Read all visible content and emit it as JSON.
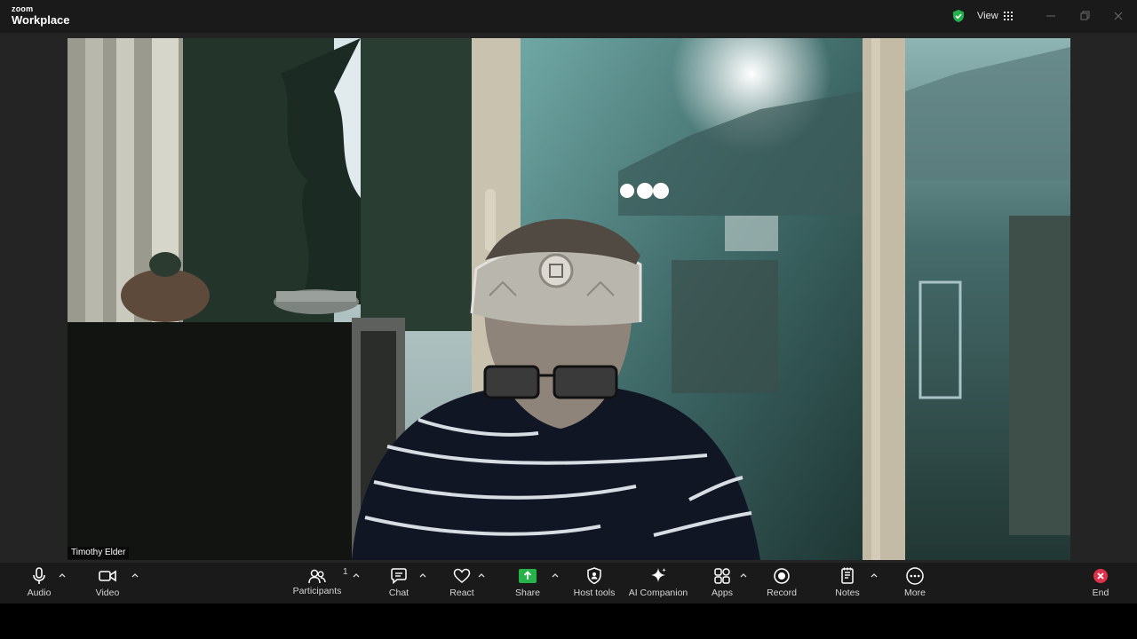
{
  "app": {
    "brand_small": "zoom",
    "brand_large": "Workplace",
    "view_label": "View"
  },
  "participant": {
    "name": "Timothy Elder"
  },
  "toolbar": {
    "audio": "Audio",
    "video": "Video",
    "participants": "Participants",
    "participants_count": "1",
    "chat": "Chat",
    "react": "React",
    "share": "Share",
    "host_tools": "Host tools",
    "ai_companion": "AI Companion",
    "apps": "Apps",
    "record": "Record",
    "notes": "Notes",
    "more": "More",
    "end": "End"
  },
  "colors": {
    "titlebar": "#1a1a1a",
    "stage": "#242424",
    "share_green": "#27b34a",
    "end_red": "#e0314b",
    "shield_green": "#23b14d"
  }
}
